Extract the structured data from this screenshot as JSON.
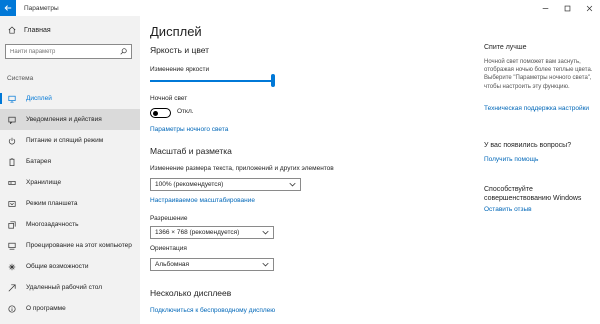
{
  "titlebar": {
    "title": "Параметры",
    "back_icon": "←",
    "min_icon": "—",
    "max_icon": "☐",
    "close_icon": "✕"
  },
  "sidebar": {
    "home_label": "Главная",
    "search_placeholder": "Найти параметр",
    "section_label": "Система",
    "items": [
      {
        "label": "Дисплей",
        "icon": "monitor-icon"
      },
      {
        "label": "Уведомления и действия",
        "icon": "notifications-icon"
      },
      {
        "label": "Питание и спящий режим",
        "icon": "power-icon"
      },
      {
        "label": "Батарея",
        "icon": "battery-icon"
      },
      {
        "label": "Хранилище",
        "icon": "storage-icon"
      },
      {
        "label": "Режим планшета",
        "icon": "tablet-icon"
      },
      {
        "label": "Многозадачность",
        "icon": "multitasking-icon"
      },
      {
        "label": "Проецирование на этот компьютер",
        "icon": "projecting-icon"
      },
      {
        "label": "Общие возможности",
        "icon": "shared-experiences-icon"
      },
      {
        "label": "Удаленный рабочий стол",
        "icon": "remote-desktop-icon"
      },
      {
        "label": "О программе",
        "icon": "info-icon"
      }
    ]
  },
  "main": {
    "title": "Дисплей",
    "brightness_heading": "Яркость и цвет",
    "brightness_label": "Изменение яркости",
    "brightness_level": 1.0,
    "night_light_label": "Ночной свет",
    "night_light_state": "Откл.",
    "night_light_settings_link": "Параметры ночного света",
    "scale_heading": "Масштаб и разметка",
    "scale_label": "Изменение размера текста, приложений и других элементов",
    "scale_value": "100% (рекомендуется)",
    "custom_scaling_link": "Настраиваемое масштабирование",
    "resolution_label": "Разрешение",
    "resolution_value": "1366 × 768 (рекомендуется)",
    "orientation_label": "Ориентация",
    "orientation_value": "Альбомная",
    "multi_display_heading": "Несколько дисплеев",
    "wireless_display_link": "Подключиться к беспроводному дисплею"
  },
  "related": {
    "sleep_better_heading": "Спите лучше",
    "sleep_better_text": "Ночной свет поможет вам заснуть, отображая ночью более теплые цвета. Выберите \"Параметры ночного света\", чтобы настроить эту функцию.",
    "tech_support_link": "Техническая поддержка настройки",
    "questions_heading": "У вас появились вопросы?",
    "get_help_link": "Получить помощь",
    "improve_heading": "Способствуйте совершенствованию Windows",
    "feedback_link": "Оставить отзыв"
  },
  "colors": {
    "accent": "#0078d7",
    "link": "#0067b8",
    "sidebar_bg": "#f2f2f2",
    "hover_bg": "#dadada"
  }
}
